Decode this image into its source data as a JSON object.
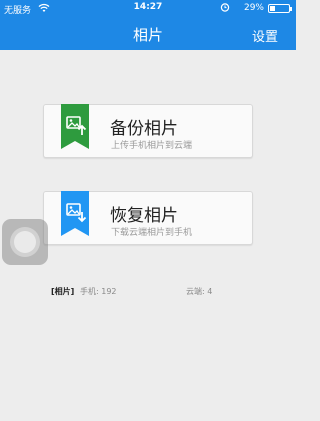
{
  "status_bar": {
    "carrier": "无服务",
    "time": "14:27",
    "battery_percent": "29%",
    "battery_level": 0.29
  },
  "nav": {
    "title": "相片",
    "settings_label": "设置"
  },
  "actions": [
    {
      "label": "备份相片",
      "subtitle": "上传手机相片到云端",
      "icon": "photo-upload-icon",
      "color": "#2e9b3e"
    },
    {
      "label": "恢复相片",
      "subtitle": "下载云端相片到手机",
      "icon": "photo-download-icon",
      "color": "#2196f3"
    }
  ],
  "stats": {
    "section_label": "[相片]",
    "phone_count": "手机: 192",
    "cloud_count": "云端: 4"
  },
  "colors": {
    "nav_bar": "#1e88e5",
    "background": "#ededed"
  }
}
